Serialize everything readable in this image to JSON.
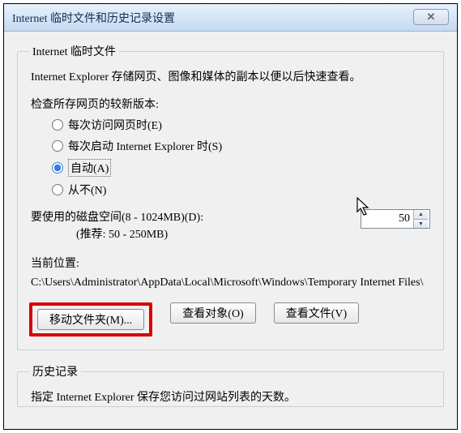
{
  "window": {
    "title": "Internet 临时文件和历史记录设置"
  },
  "tempFiles": {
    "legend": "Internet 临时文件",
    "desc": "Internet Explorer 存储网页、图像和媒体的副本以便以后快速查看。",
    "checkLabel": "检查所存网页的较新版本:",
    "radio": {
      "everyVisit": "每次访问网页时(E)",
      "everyStart": "每次启动 Internet Explorer 时(S)",
      "auto": "自动(A)",
      "never": "从不(N)"
    },
    "diskLabel": "要使用的磁盘空间(8 - 1024MB)(D):",
    "recommend": "(推荐: 50 - 250MB)",
    "diskValue": "50",
    "locationLabel": "当前位置:",
    "locationPath": "C:\\Users\\Administrator\\AppData\\Local\\Microsoft\\Windows\\Temporary Internet Files\\"
  },
  "buttons": {
    "moveFolder": "移动文件夹(M)...",
    "viewObjects": "查看对象(O)",
    "viewFiles": "查看文件(V)"
  },
  "history": {
    "legend": "历史记录",
    "desc": "指定 Internet Explorer 保存您访问过网站列表的天数。"
  }
}
